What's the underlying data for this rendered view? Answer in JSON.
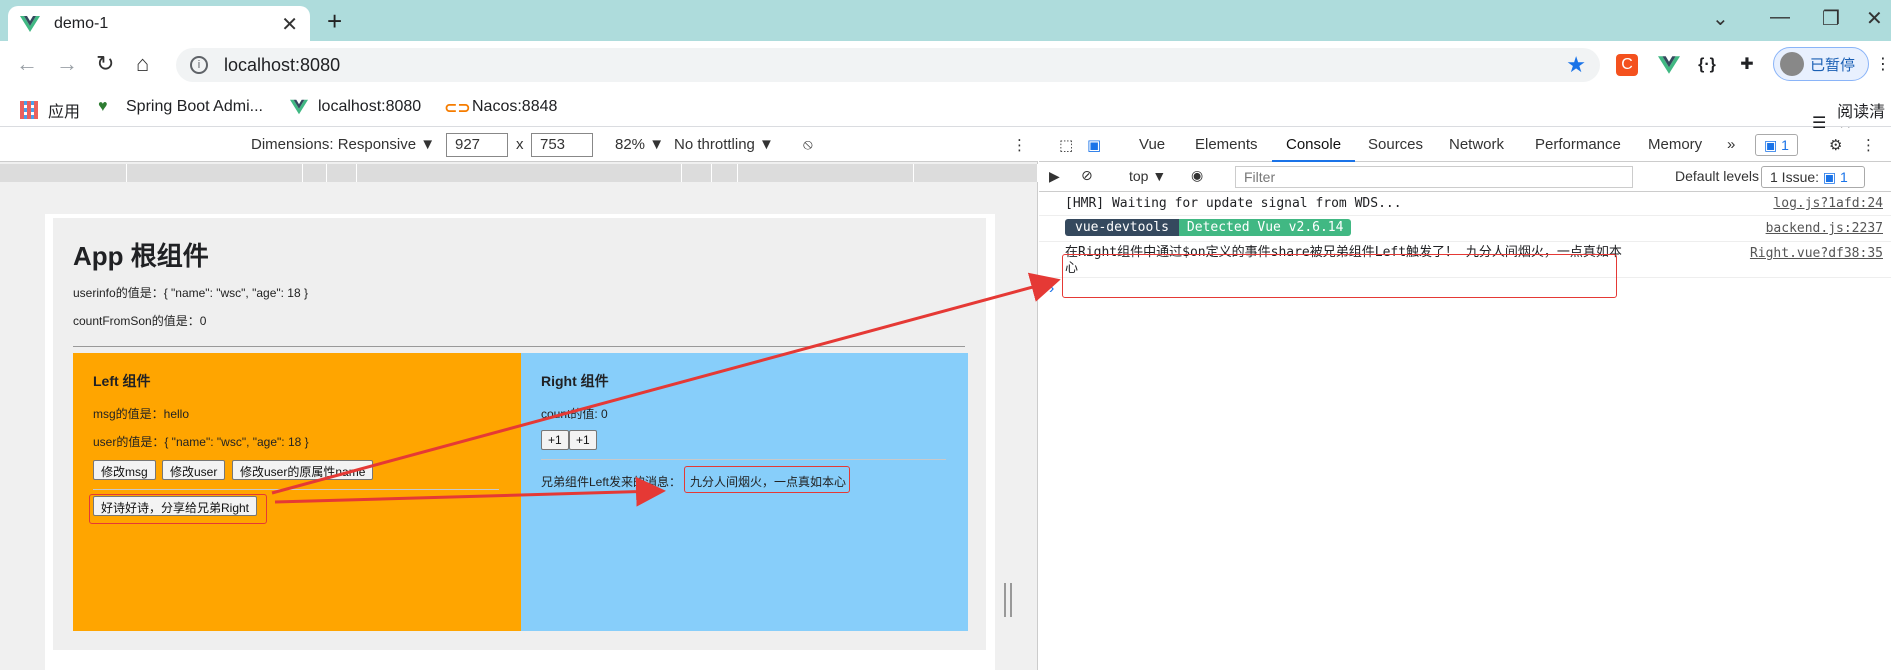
{
  "browser": {
    "tab_title": "demo-1",
    "url": "localhost:8080",
    "profile_label": "已暂停"
  },
  "bookmarks": [
    {
      "label": "应用"
    },
    {
      "label": "Spring Boot Admi..."
    },
    {
      "label": "localhost:8080"
    },
    {
      "label": "Nacos:8848"
    },
    {
      "label": "阅读清单"
    }
  ],
  "devbar": {
    "dimensions": "Dimensions: Responsive ▼",
    "width": "927",
    "times": "x",
    "height": "753",
    "zoom": "82% ▼",
    "throttling": "No throttling ▼"
  },
  "app": {
    "title": "App 根组件",
    "userinfo_line": "userinfo的值是：{ \"name\": \"wsc\", \"age\": 18 }",
    "count_line": "countFromSon的值是：0",
    "left": {
      "title": "Left 组件",
      "msg_line": "msg的值是：hello",
      "user_line": "user的值是：{ \"name\": \"wsc\", \"age\": 18 }",
      "btn_msg": "修改msg",
      "btn_user": "修改user",
      "btn_user_name": "修改user的原属性name",
      "btn_share": "好诗好诗，分享给兄弟Right"
    },
    "right": {
      "title": "Right 组件",
      "count_line": "count的值: 0",
      "btn_plus1": "+1",
      "btn_plus2": "+1",
      "msg_label": "兄弟组件Left发来的消息：",
      "msg_value": "九分人间烟火，一点真如本心"
    }
  },
  "devtools": {
    "tabs": [
      "Vue",
      "Elements",
      "Console",
      "Sources",
      "Network",
      "Performance",
      "Memory",
      "»"
    ],
    "active_tab": "Console",
    "msg_badge": "1",
    "context": "top ▼",
    "filter_placeholder": "Filter",
    "levels": "Default levels ▼",
    "issues": "1 Issue:",
    "issues_count": "1",
    "logs": [
      {
        "text": "[HMR] Waiting for update signal from WDS...",
        "source": "log.js?1afd:24"
      },
      {
        "tag1": "vue-devtools",
        "tag2": "Detected Vue v2.6.14",
        "source": "backend.js:2237"
      },
      {
        "text": "在Right组件中通过$on定义的事件share被兄弟组件Left触发了！ 九分人间烟火，一点真如本心",
        "source": "Right.vue?df38:35"
      }
    ],
    "prompt": "›"
  },
  "colors": {
    "left_bg": "#ffa500",
    "right_bg": "#87cefa",
    "annotation": "#e53935"
  }
}
